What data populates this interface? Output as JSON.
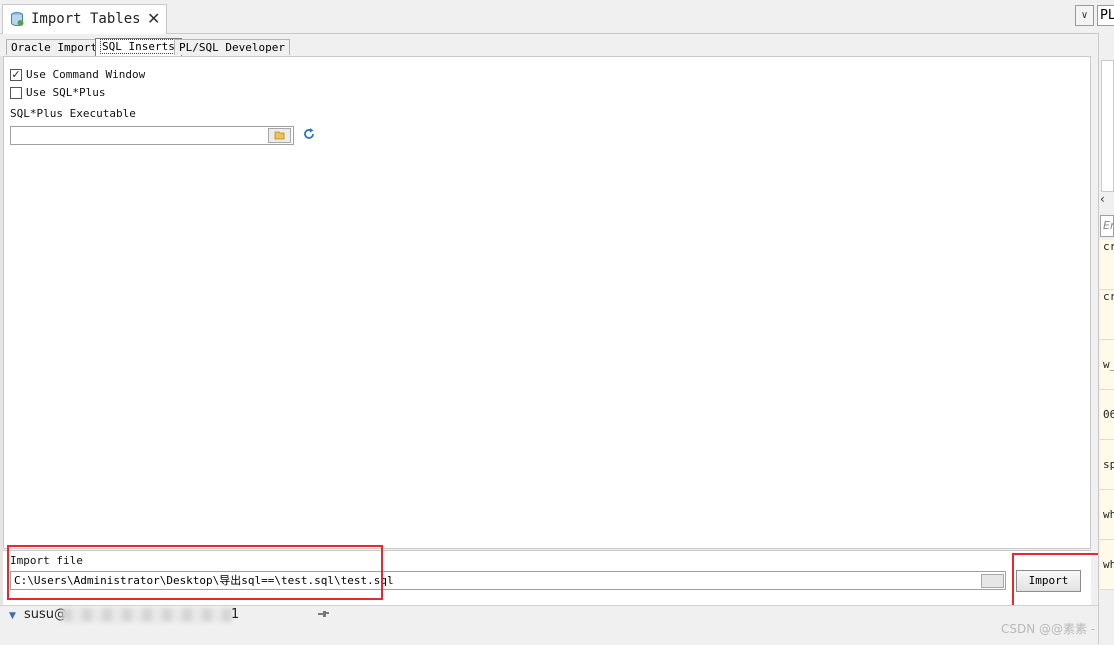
{
  "window": {
    "tab_title": "Import Tables",
    "close_glyph": "✕",
    "dropdown_glyph": "∨",
    "right_combo_text": "PL"
  },
  "subtabs": [
    {
      "label": "Oracle Import",
      "active": false
    },
    {
      "label": "SQL Inserts",
      "active": true
    },
    {
      "label": "PL/SQL Developer",
      "active": false
    }
  ],
  "options": {
    "use_command_window": {
      "label": "Use Command Window",
      "checked": true
    },
    "use_sqlplus": {
      "label": "Use SQL*Plus",
      "checked": false
    },
    "sqlplus_executable_label": "SQL*Plus Executable",
    "sqlplus_executable_value": ""
  },
  "import": {
    "file_label": "Import file",
    "file_value": "C:\\Users\\Administrator\\Desktop\\导出sql==\\test.sql\\test.sql",
    "button_label": "Import"
  },
  "status": {
    "connection_label": "susu@",
    "connection_suffix": "1"
  },
  "right_panel": {
    "filter_placeholder": "Er",
    "items": [
      "cr",
      "cr",
      "w_",
      "06",
      "sp",
      "wh",
      "wh"
    ]
  },
  "watermark": "CSDN @@素素 -",
  "icons": {
    "doc_tab": "database-import-icon",
    "folder": "folder-open-icon",
    "refresh": "refresh-icon",
    "pin": "pin-icon",
    "connection": "triangle-down-icon"
  },
  "colors": {
    "highlight_box": "#e32b2b",
    "panel_bg": "#ffffff",
    "chrome_bg": "#f0f0f0"
  }
}
